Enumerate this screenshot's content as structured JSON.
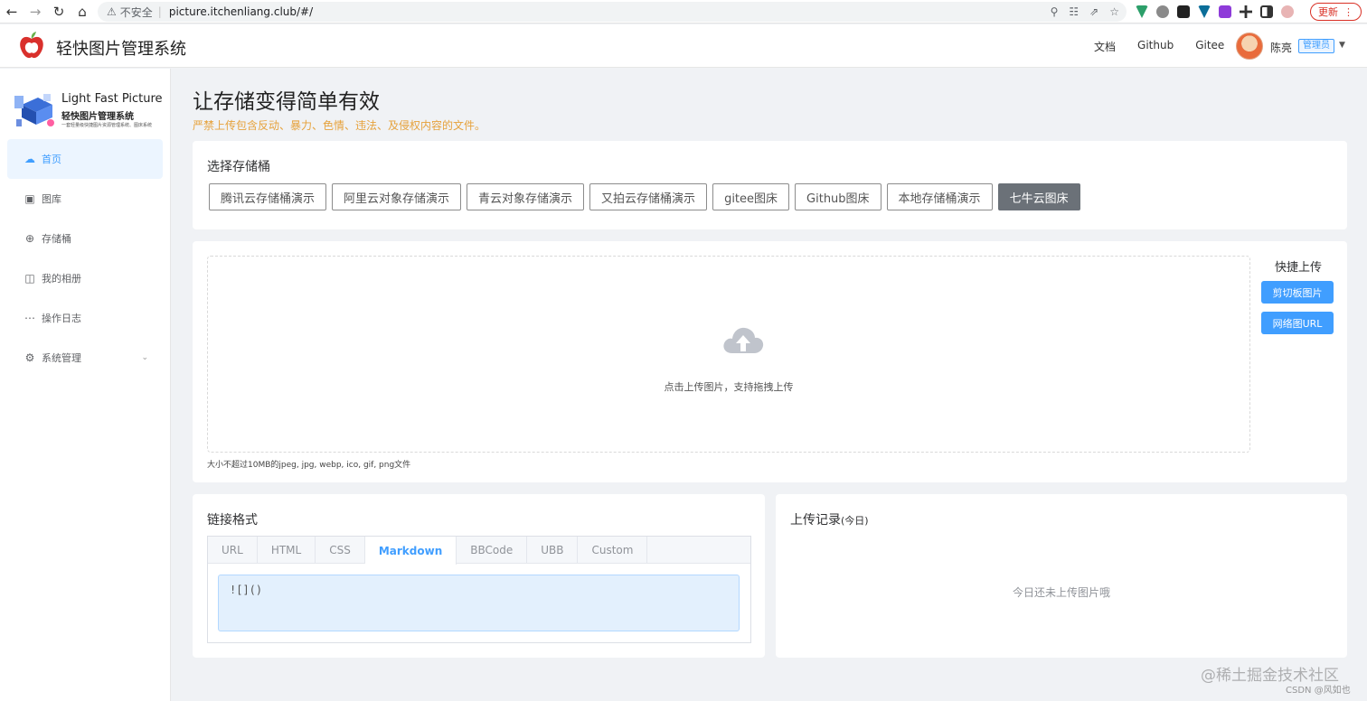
{
  "browser": {
    "security_label": "不安全",
    "url": "picture.itchenliang.club/#/",
    "update_label": "更新"
  },
  "header": {
    "title": "轻快图片管理系统",
    "links": [
      "文档",
      "Github",
      "Gitee"
    ],
    "user_name": "陈亮",
    "user_role": "管理员"
  },
  "sidebar": {
    "logo_en": "Light Fast Picture",
    "logo_cn": "轻快图片管理系统",
    "logo_sub": "一套轻量级快捷图片资源管理系统、图床系统",
    "items": [
      {
        "label": "首页",
        "icon": "cloud-upload-icon",
        "active": true
      },
      {
        "label": "图库",
        "icon": "picture-icon"
      },
      {
        "label": "存储桶",
        "icon": "bucket-icon"
      },
      {
        "label": "我的相册",
        "icon": "album-icon"
      },
      {
        "label": "操作日志",
        "icon": "log-icon"
      },
      {
        "label": "系统管理",
        "icon": "gear-icon",
        "expandable": true
      }
    ]
  },
  "main": {
    "title": "让存储变得简单有效",
    "warning": "严禁上传包含反动、暴力、色情、违法、及侵权内容的文件。",
    "warning_color": "#e6a23c"
  },
  "bucket": {
    "title": "选择存储桶",
    "options": [
      "腾讯云存储桶演示",
      "阿里云对象存储演示",
      "青云对象存储演示",
      "又拍云存储桶演示",
      "gitee图床",
      "Github图床",
      "本地存储桶演示",
      "七牛云图床"
    ],
    "selected": "七牛云图床"
  },
  "upload": {
    "drop_text": "点击上传图片，支持拖拽上传",
    "tip": "大小不超过10MB的jpeg, jpg, webp, ico, gif, png文件",
    "quick_title": "快捷上传",
    "clipboard_label": "剪切板图片",
    "url_label": "网络图URL",
    "accent_color": "#409eff"
  },
  "link_format": {
    "title": "链接格式",
    "tabs": [
      "URL",
      "HTML",
      "CSS",
      "Markdown",
      "BBCode",
      "UBB",
      "Custom"
    ],
    "active_tab": "Markdown",
    "value": "![]()"
  },
  "history": {
    "title": "上传记录",
    "title_suffix": "(今日)",
    "empty_text": "今日还未上传图片哦"
  },
  "watermark": {
    "site": "@稀土掘金技术社区",
    "credit": "CSDN @风如也"
  }
}
